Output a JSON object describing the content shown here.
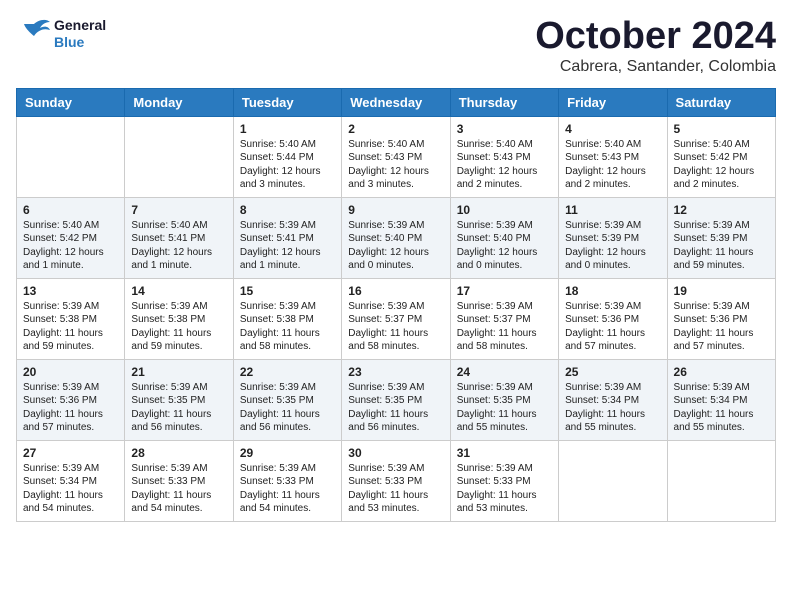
{
  "header": {
    "logo_line1": "General",
    "logo_line2": "Blue",
    "month": "October 2024",
    "location": "Cabrera, Santander, Colombia"
  },
  "weekdays": [
    "Sunday",
    "Monday",
    "Tuesday",
    "Wednesday",
    "Thursday",
    "Friday",
    "Saturday"
  ],
  "weeks": [
    [
      {
        "day": "",
        "info": ""
      },
      {
        "day": "",
        "info": ""
      },
      {
        "day": "1",
        "info": "Sunrise: 5:40 AM\nSunset: 5:44 PM\nDaylight: 12 hours\nand 3 minutes."
      },
      {
        "day": "2",
        "info": "Sunrise: 5:40 AM\nSunset: 5:43 PM\nDaylight: 12 hours\nand 3 minutes."
      },
      {
        "day": "3",
        "info": "Sunrise: 5:40 AM\nSunset: 5:43 PM\nDaylight: 12 hours\nand 2 minutes."
      },
      {
        "day": "4",
        "info": "Sunrise: 5:40 AM\nSunset: 5:43 PM\nDaylight: 12 hours\nand 2 minutes."
      },
      {
        "day": "5",
        "info": "Sunrise: 5:40 AM\nSunset: 5:42 PM\nDaylight: 12 hours\nand 2 minutes."
      }
    ],
    [
      {
        "day": "6",
        "info": "Sunrise: 5:40 AM\nSunset: 5:42 PM\nDaylight: 12 hours\nand 1 minute."
      },
      {
        "day": "7",
        "info": "Sunrise: 5:40 AM\nSunset: 5:41 PM\nDaylight: 12 hours\nand 1 minute."
      },
      {
        "day": "8",
        "info": "Sunrise: 5:39 AM\nSunset: 5:41 PM\nDaylight: 12 hours\nand 1 minute."
      },
      {
        "day": "9",
        "info": "Sunrise: 5:39 AM\nSunset: 5:40 PM\nDaylight: 12 hours\nand 0 minutes."
      },
      {
        "day": "10",
        "info": "Sunrise: 5:39 AM\nSunset: 5:40 PM\nDaylight: 12 hours\nand 0 minutes."
      },
      {
        "day": "11",
        "info": "Sunrise: 5:39 AM\nSunset: 5:39 PM\nDaylight: 12 hours\nand 0 minutes."
      },
      {
        "day": "12",
        "info": "Sunrise: 5:39 AM\nSunset: 5:39 PM\nDaylight: 11 hours\nand 59 minutes."
      }
    ],
    [
      {
        "day": "13",
        "info": "Sunrise: 5:39 AM\nSunset: 5:38 PM\nDaylight: 11 hours\nand 59 minutes."
      },
      {
        "day": "14",
        "info": "Sunrise: 5:39 AM\nSunset: 5:38 PM\nDaylight: 11 hours\nand 59 minutes."
      },
      {
        "day": "15",
        "info": "Sunrise: 5:39 AM\nSunset: 5:38 PM\nDaylight: 11 hours\nand 58 minutes."
      },
      {
        "day": "16",
        "info": "Sunrise: 5:39 AM\nSunset: 5:37 PM\nDaylight: 11 hours\nand 58 minutes."
      },
      {
        "day": "17",
        "info": "Sunrise: 5:39 AM\nSunset: 5:37 PM\nDaylight: 11 hours\nand 58 minutes."
      },
      {
        "day": "18",
        "info": "Sunrise: 5:39 AM\nSunset: 5:36 PM\nDaylight: 11 hours\nand 57 minutes."
      },
      {
        "day": "19",
        "info": "Sunrise: 5:39 AM\nSunset: 5:36 PM\nDaylight: 11 hours\nand 57 minutes."
      }
    ],
    [
      {
        "day": "20",
        "info": "Sunrise: 5:39 AM\nSunset: 5:36 PM\nDaylight: 11 hours\nand 57 minutes."
      },
      {
        "day": "21",
        "info": "Sunrise: 5:39 AM\nSunset: 5:35 PM\nDaylight: 11 hours\nand 56 minutes."
      },
      {
        "day": "22",
        "info": "Sunrise: 5:39 AM\nSunset: 5:35 PM\nDaylight: 11 hours\nand 56 minutes."
      },
      {
        "day": "23",
        "info": "Sunrise: 5:39 AM\nSunset: 5:35 PM\nDaylight: 11 hours\nand 56 minutes."
      },
      {
        "day": "24",
        "info": "Sunrise: 5:39 AM\nSunset: 5:35 PM\nDaylight: 11 hours\nand 55 minutes."
      },
      {
        "day": "25",
        "info": "Sunrise: 5:39 AM\nSunset: 5:34 PM\nDaylight: 11 hours\nand 55 minutes."
      },
      {
        "day": "26",
        "info": "Sunrise: 5:39 AM\nSunset: 5:34 PM\nDaylight: 11 hours\nand 55 minutes."
      }
    ],
    [
      {
        "day": "27",
        "info": "Sunrise: 5:39 AM\nSunset: 5:34 PM\nDaylight: 11 hours\nand 54 minutes."
      },
      {
        "day": "28",
        "info": "Sunrise: 5:39 AM\nSunset: 5:33 PM\nDaylight: 11 hours\nand 54 minutes."
      },
      {
        "day": "29",
        "info": "Sunrise: 5:39 AM\nSunset: 5:33 PM\nDaylight: 11 hours\nand 54 minutes."
      },
      {
        "day": "30",
        "info": "Sunrise: 5:39 AM\nSunset: 5:33 PM\nDaylight: 11 hours\nand 53 minutes."
      },
      {
        "day": "31",
        "info": "Sunrise: 5:39 AM\nSunset: 5:33 PM\nDaylight: 11 hours\nand 53 minutes."
      },
      {
        "day": "",
        "info": ""
      },
      {
        "day": "",
        "info": ""
      }
    ]
  ]
}
